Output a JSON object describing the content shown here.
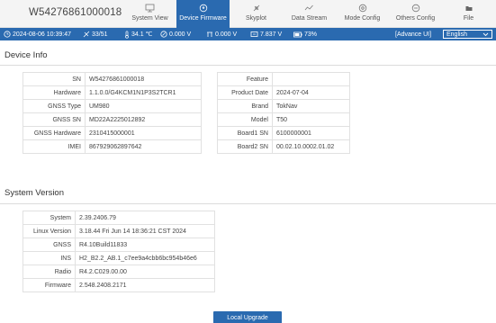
{
  "header": {
    "device_id": "W54276861000018",
    "tabs": [
      {
        "label": "System View",
        "icon": "monitor-icon"
      },
      {
        "label": "Device Firmware",
        "icon": "firmware-icon",
        "active": true
      },
      {
        "label": "Skyplot",
        "icon": "satellite-icon"
      },
      {
        "label": "Data Stream",
        "icon": "data-stream-icon"
      },
      {
        "label": "Mode Config",
        "icon": "mode-config-icon"
      },
      {
        "label": "Others Config",
        "icon": "others-config-icon"
      },
      {
        "label": "File",
        "icon": "folder-icon"
      }
    ]
  },
  "status": {
    "datetime": "2024-08-06 10:39:47",
    "satellites": "33/51",
    "temperature": "34.1 ℃",
    "voltage1": "0.000 V",
    "voltage2": "0.000 V",
    "voltage3": "7.837 V",
    "battery": "73%",
    "advance_ui": "[Advance UI]",
    "language": "English"
  },
  "device_info": {
    "title": "Device Info",
    "left_rows": [
      {
        "key": "SN",
        "value": "W54276861000018"
      },
      {
        "key": "Hardware",
        "value": "1.1.0.0/G4KCM1N1P3S2TCR1"
      },
      {
        "key": "GNSS Type",
        "value": "UM980"
      },
      {
        "key": "GNSS SN",
        "value": "MD22A2225012892"
      },
      {
        "key": "GNSS Hardware",
        "value": "2310415000001"
      },
      {
        "key": "IMEI",
        "value": "867929062897642"
      }
    ],
    "right_rows": [
      {
        "key": "Feature",
        "value": ""
      },
      {
        "key": "Product Date",
        "value": "2024-07-04"
      },
      {
        "key": "Brand",
        "value": "TokNav"
      },
      {
        "key": "Model",
        "value": "T50"
      },
      {
        "key": "Board1 SN",
        "value": "6100000001"
      },
      {
        "key": "Board2 SN",
        "value": "00.02.10.0002.01.02"
      }
    ]
  },
  "system_version": {
    "title": "System Version",
    "rows": [
      {
        "key": "System",
        "value": "2.39.2406.79"
      },
      {
        "key": "Linux Version",
        "value": "3.18.44 Fri Jun 14 18:36:21 CST 2024"
      },
      {
        "key": "GNSS",
        "value": "R4.10Build11833"
      },
      {
        "key": "INS",
        "value": "H2_B2.2_AB.1_c7ee9a4cbb6bc954b46e6"
      },
      {
        "key": "Radio",
        "value": "R4.2.C029.00.00"
      },
      {
        "key": "Firmware",
        "value": "2.548.2408.2171"
      }
    ]
  },
  "actions": {
    "upgrade_label": "Local Upgrade"
  },
  "colors": {
    "accent": "#2a6ab0",
    "header_bg": "#f4f4f4"
  }
}
